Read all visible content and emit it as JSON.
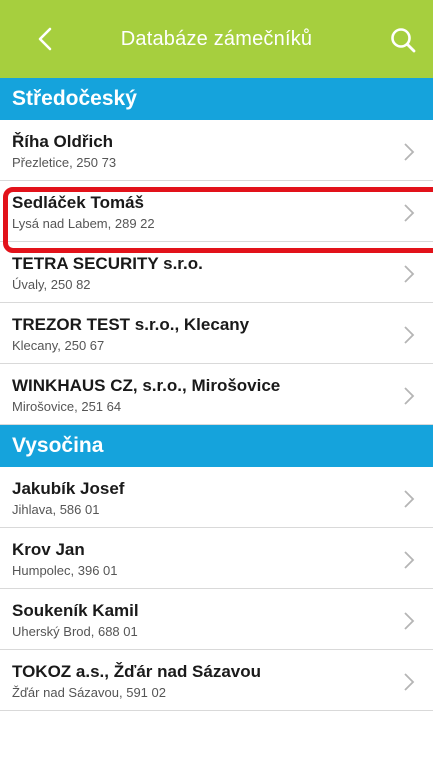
{
  "header": {
    "title": "Databáze zámečníků",
    "back_icon": "chevron-left-icon",
    "search_icon": "search-icon",
    "bg_color": "#a6cf3e"
  },
  "sections": [
    {
      "title": "Středočeský",
      "items": [
        {
          "name": "Říha Oldřich",
          "address": "Přezletice, 250 73"
        },
        {
          "name": "Sedláček Tomáš",
          "address": "Lysá nad Labem, 289 22"
        },
        {
          "name": "TETRA SECURITY s.r.o.",
          "address": "Úvaly, 250 82"
        },
        {
          "name": "TREZOR TEST s.r.o., Klecany",
          "address": "Klecany, 250 67"
        },
        {
          "name": "WINKHAUS CZ, s.r.o., Mirošovice",
          "address": "Mirošovice, 251 64"
        }
      ]
    },
    {
      "title": "Vysočina",
      "items": [
        {
          "name": "Jakubík Josef",
          "address": "Jihlava, 586 01"
        },
        {
          "name": "Krov Jan",
          "address": "Humpolec, 396 01"
        },
        {
          "name": "Soukeník Kamil",
          "address": "Uherský Brod, 688 01"
        },
        {
          "name": "TOKOZ a.s., Žďár nad Sázavou",
          "address": "Žďár nad Sázavou, 591 02"
        }
      ]
    }
  ],
  "colors": {
    "section_bg": "#15a3dc",
    "highlight": "#e2121a"
  }
}
